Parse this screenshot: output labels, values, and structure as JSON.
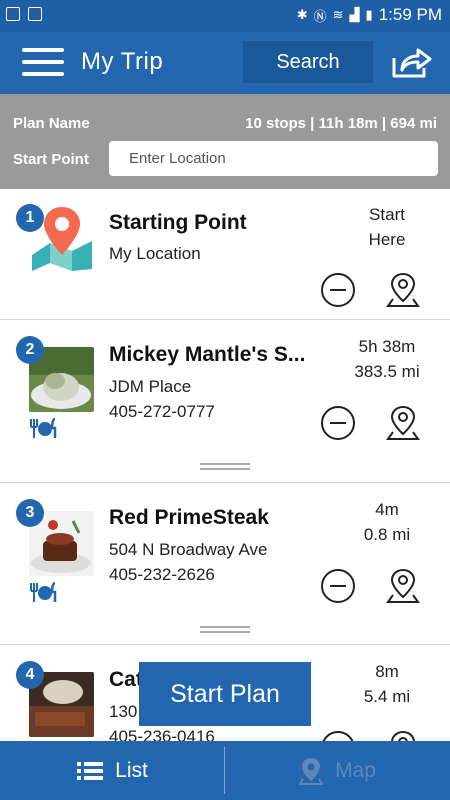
{
  "status_bar": {
    "time": "1:59 PM"
  },
  "app_bar": {
    "title": "My Trip",
    "search_label": "Search"
  },
  "plan": {
    "name_label": "Plan Name",
    "summary": "10 stops | 11h 18m | 694 mi",
    "start_point_label": "Start Point",
    "location_placeholder": "Enter Location"
  },
  "stops": [
    {
      "number": "1",
      "name": "Starting Point",
      "line2": "My Location",
      "line3": "",
      "meta1": "Start",
      "meta2": "Here",
      "icon": "map-pin-illustration"
    },
    {
      "number": "2",
      "name": "Mickey Mantle's S...",
      "line2": "JDM Place",
      "line3": "405-272-0777",
      "meta1": "5h 38m",
      "meta2": "383.5 mi",
      "icon": "restaurant-icon"
    },
    {
      "number": "3",
      "name": "Red PrimeSteak",
      "line2": "504 N Broadway Ave",
      "line3": "405-232-2626",
      "meta1": "4m",
      "meta2": "0.8 mi",
      "icon": "restaurant-icon"
    },
    {
      "number": "4",
      "name": "Cat",
      "line2": "130",
      "line3": "405-236-0416",
      "meta1": "8m",
      "meta2": "5.4 mi",
      "icon": "restaurant-icon"
    }
  ],
  "start_plan_label": "Start Plan",
  "tabs": {
    "list": "List",
    "map": "Map"
  }
}
